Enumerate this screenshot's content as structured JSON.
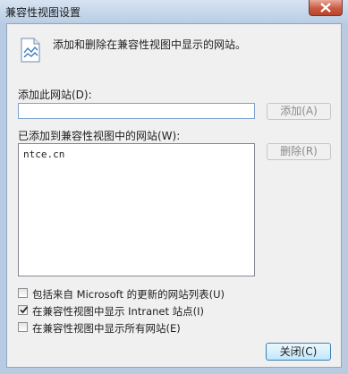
{
  "window": {
    "title": "兼容性视图设置"
  },
  "info": {
    "text": "添加和删除在兼容性视图中显示的网站。"
  },
  "add_site": {
    "label": "添加此网站(D):",
    "value": "",
    "button_label": "添加(A)"
  },
  "site_list": {
    "label": "已添加到兼容性视图中的网站(W):",
    "items": [
      "ntce.cn"
    ],
    "remove_label": "删除(R)"
  },
  "options": [
    {
      "label": "包括来自 Microsoft 的更新的网站列表(U)",
      "checked": false
    },
    {
      "label": "在兼容性视图中显示 Intranet 站点(I)",
      "checked": true
    },
    {
      "label": "在兼容性视图中显示所有网站(E)",
      "checked": false
    }
  ],
  "footer": {
    "close_label": "关闭(C)"
  },
  "colors": {
    "titlebar": "#c4d6ea",
    "client_bg": "#f0f0f0",
    "close_red": "#c95a41"
  }
}
